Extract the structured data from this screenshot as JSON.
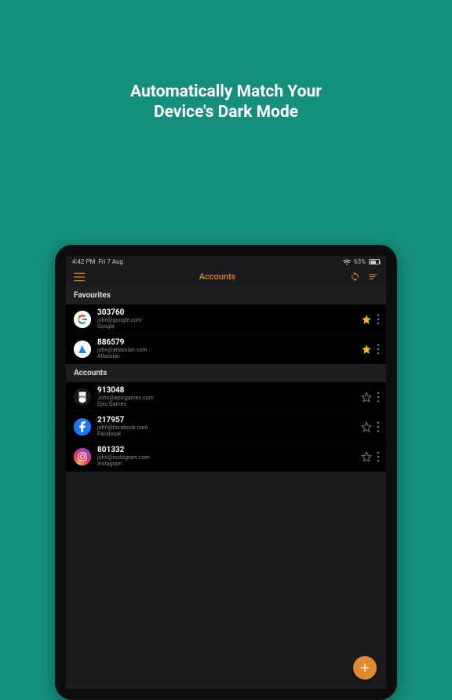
{
  "promo": {
    "headline_line1": "Automatically Match Your",
    "headline_line2": "Device's Dark Mode"
  },
  "status": {
    "time": "4:42 PM",
    "date": "Fri 7 Aug",
    "battery_percent": "63%"
  },
  "nav": {
    "title": "Accounts"
  },
  "sections": {
    "favourites_label": "Favourites",
    "accounts_label": "Accounts"
  },
  "favourites": [
    {
      "code": "303760",
      "email": "john@google.com",
      "service": "Google",
      "starred": true,
      "icon": "google"
    },
    {
      "code": "886579",
      "email": "john@atlassian.com",
      "service": "Atlassian",
      "starred": true,
      "icon": "atlassian"
    }
  ],
  "accounts": [
    {
      "code": "913048",
      "email": "John@epicgames.com",
      "service": "Epic Games",
      "starred": false,
      "icon": "epic"
    },
    {
      "code": "217957",
      "email": "john@facebook.com",
      "service": "Facebook",
      "starred": false,
      "icon": "facebook"
    },
    {
      "code": "801332",
      "email": "john@instagram.com",
      "service": "Instagram",
      "starred": false,
      "icon": "instagram"
    }
  ],
  "colors": {
    "accent": "#d68a2e",
    "star": "#f1b81f"
  }
}
